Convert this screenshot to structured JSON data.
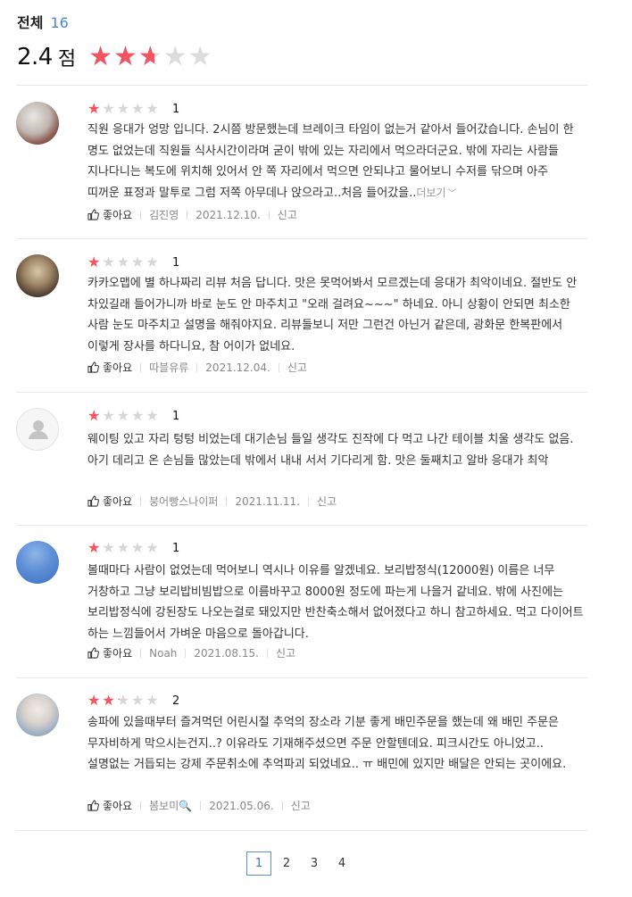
{
  "summary": {
    "total_label": "전체",
    "total_count": "16",
    "score": "2.4",
    "score_unit": "점",
    "stars_rating": 2.4,
    "stars_max": 5
  },
  "reviews": [
    {
      "rating": 1,
      "rating_label": "1",
      "text": "직원 응대가 엉망 입니다. 2시쯤 방문했는데 브레이크 타임이 없는거 같아서 들어갔습니다.  손님이 한 명도 없었는데 직원들 식사시간이라며  굳이 밖에 있는 자리에서 먹으라더군요. 밖에 자리는 사람들 지나다니는 복도에 위치해 있어서 안 쪽 자리에서 먹으면 안되냐고 물어보니 수저를 닦으며 아주 띠꺼운 표정과 말투로 그럼 저쪽 아무데나 앉으라고..처음 들어갔을..",
      "more": "더보기",
      "like_label": "좋아요",
      "author": "김진영",
      "date": "2021.12.10.",
      "report": "신고"
    },
    {
      "rating": 1,
      "rating_label": "1",
      "text": "카카오맵에 별 하나짜리 리뷰 처음 답니다. 맛은 못먹어봐서 모르겠는데 응대가 최악이네요. 절반도 안 차있길래 들어가니까 바로 눈도 안 마주치고 \"오래 걸려요~~~\" 하네요. 아니 상황이 안되면 최소한 사람 눈도 마주치고 설명을 해줘야지요.  리뷰들보니 저만 그런건 아닌거 같은데, 광화문 한복판에서 이렇게 장사를 하다니요, 참 어이가 없네요.",
      "like_label": "좋아요",
      "author": "따블유류",
      "date": "2021.12.04.",
      "report": "신고"
    },
    {
      "rating": 1,
      "rating_label": "1",
      "text": "웨이팅 있고 자리 텅텅 비었는데 대기손님 들일 생각도 진작에 다 먹고 나간 테이블 치울 생각도 없음. 아기 데리고 온 손님들 많았는데 밖에서 내내 서서 기다리게 함. 맛은 둘째치고 알바 응대가 최악",
      "like_label": "좋아요",
      "author": "붕어빵스나이퍼",
      "date": "2021.11.11.",
      "report": "신고"
    },
    {
      "rating": 1,
      "rating_label": "1",
      "text": "볼때마다 사람이 없었는데 먹어보니 역시나 이유를  알겠네요. 보리밥정식(12000원) 이름은 너무 거창하고 그냥 보리밥비빔밥으로 이름바꾸고 8000원 정도에 파는게 나을거 같네요. 밖에 사진에는 보리밥정식에 강된장도 나오는걸로 돼있지만 반찬축소해서 없어졌다고 하니 참고하세요. 먹고 다이어트 하는 느낌들어서 가벼운 마음으로 돌아갑니다.",
      "like_label": "좋아요",
      "author": "Noah",
      "date": "2021.08.15.",
      "report": "신고"
    },
    {
      "rating": 2,
      "rating_label": "2",
      "text": "송파에 있을때부터 즐겨먹던 어린시절 추억의 장소라 기분 좋게 배민주문을 했는데 왜 배민 주문은 무자비하게 막으시는건지..? 이유라도 기재해주셨으면 주문 안할텐데요. 피크시간도 아니었고.. 설명없는 거듭되는 강제 주문취소에 추억파괴 되었네요.. ㅠ 배민에 있지만 배달은 안되는 곳이에요.",
      "like_label": "좋아요",
      "author": "봄보미🔍",
      "date": "2021.05.06.",
      "report": "신고"
    }
  ],
  "pagination": {
    "pages": [
      "1",
      "2",
      "3",
      "4"
    ],
    "current": "1"
  },
  "colors": {
    "star_filled": "#f25462",
    "star_empty": "#dcdcdc",
    "accent": "#4a86c8"
  },
  "icons": {
    "like": "thumbs-up-icon",
    "more": "chevron-down-icon",
    "default_avatar": "user-silhouette-icon"
  }
}
